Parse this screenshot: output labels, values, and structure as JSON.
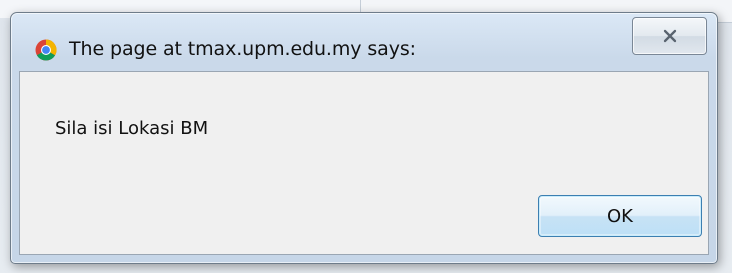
{
  "dialog": {
    "title": "The page at tmax.upm.edu.my says:",
    "message": "Sila isi Lokasi BM",
    "ok_label": "OK",
    "icons": {
      "app": "chrome-icon",
      "close": "close-icon"
    }
  },
  "colors": {
    "titlebar": "#cad9ea",
    "content_bg": "#f0f0f0",
    "ok_border": "#3c7fb1"
  }
}
